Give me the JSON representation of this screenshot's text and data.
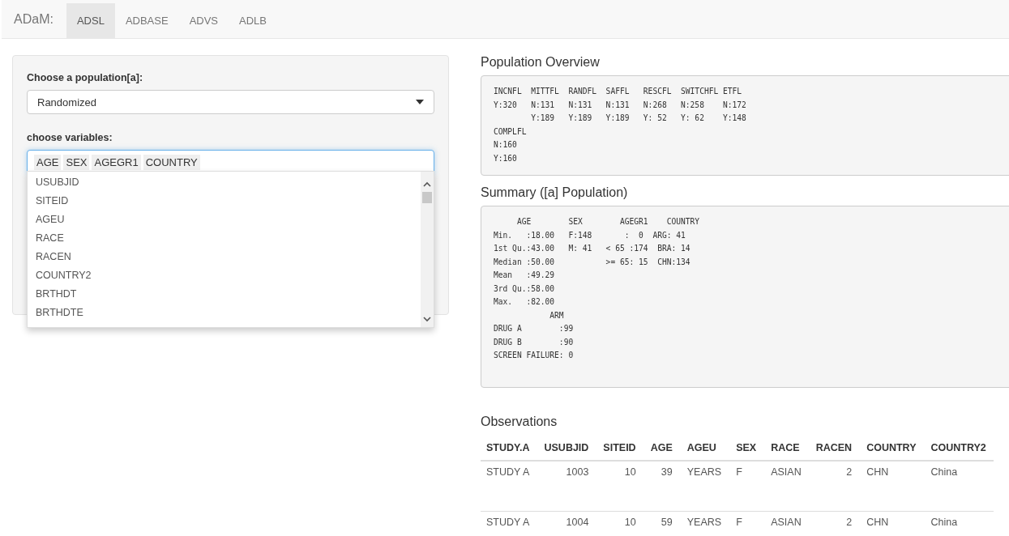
{
  "navbar": {
    "brand": "ADaM:",
    "tabs": [
      {
        "label": "ADSL",
        "selected": true
      },
      {
        "label": "ADBASE",
        "selected": false
      },
      {
        "label": "ADVS",
        "selected": false
      },
      {
        "label": "ADLB",
        "selected": false
      }
    ]
  },
  "sidebar": {
    "population": {
      "label": "Choose a population[a]:",
      "value": "Randomized"
    },
    "variables": {
      "label": "choose variables:",
      "chips": [
        "AGE",
        "SEX",
        "AGEGR1",
        "COUNTRY"
      ],
      "options": [
        "USUBJID",
        "SITEID",
        "AGEU",
        "RACE",
        "RACEN",
        "COUNTRY2",
        "BRTHDT",
        "BRTHDTE"
      ]
    }
  },
  "overview": {
    "title": "Population Overview",
    "text": "INCNFL  MITTFL  RANDFL  SAFFL   RESCFL  SWITCHFL ETFL\nY:320   N:131   N:131   N:131   N:268   N:258    N:172\n        Y:189   Y:189   Y:189   Y: 52   Y: 62    Y:148\nCOMPLFL\nN:160\nY:160"
  },
  "summary": {
    "title": "Summary ([a] Population)",
    "text": "     AGE        SEX        AGEGR1    COUNTRY\nMin.   :18.00   F:148       :  0  ARG: 41\n1st Qu.:43.00   M: 41   < 65 :174  BRA: 14\nMedian :50.00           >= 65: 15  CHN:134\nMean   :49.29\n3rd Qu.:58.00\nMax.   :82.00\n            ARM\nDRUG A        :99\nDRUG B        :90\nSCREEN FAILURE: 0"
  },
  "observations": {
    "title": "Observations",
    "columns": [
      {
        "label": "STUDY.A",
        "kind": "text"
      },
      {
        "label": "USUBJID",
        "kind": "number"
      },
      {
        "label": "SITEID",
        "kind": "number"
      },
      {
        "label": "AGE",
        "kind": "number"
      },
      {
        "label": "AGEU",
        "kind": "text"
      },
      {
        "label": "SEX",
        "kind": "text"
      },
      {
        "label": "RACE",
        "kind": "text"
      },
      {
        "label": "RACEN",
        "kind": "number"
      },
      {
        "label": "COUNTRY",
        "kind": "text"
      },
      {
        "label": "COUNTRY2",
        "kind": "text"
      }
    ],
    "rows": [
      [
        "STUDY A",
        "1003",
        "10",
        "39",
        "YEARS",
        "F",
        "ASIAN",
        "2",
        "CHN",
        "China"
      ],
      [
        "STUDY A",
        "1004",
        "10",
        "59",
        "YEARS",
        "F",
        "ASIAN",
        "2",
        "CHN",
        "China"
      ]
    ]
  }
}
